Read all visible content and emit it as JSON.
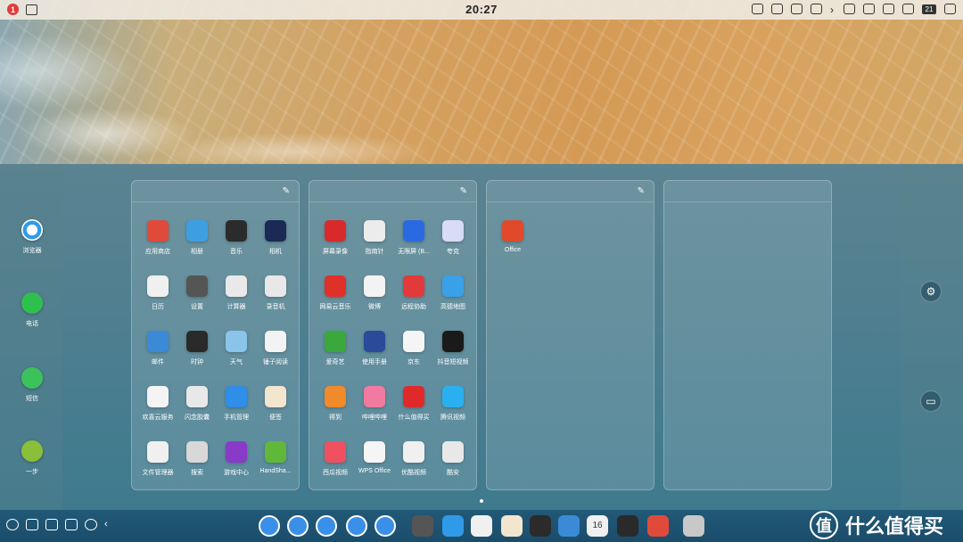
{
  "status_bar": {
    "notification_count": "1",
    "time": "20:27",
    "battery": "21"
  },
  "left_dock": [
    {
      "label": "浏览器",
      "icon": "browser-icon",
      "color": "#2f9be8"
    },
    {
      "label": "电话",
      "icon": "phone-icon",
      "color": "#2fbf4f"
    },
    {
      "label": "短信",
      "icon": "message-icon",
      "color": "#3cc25a"
    },
    {
      "label": "一步",
      "icon": "onestep-icon",
      "color": "#8abf3a"
    }
  ],
  "panels": [
    {
      "edit_icon": "pencil-icon",
      "apps": [
        {
          "label": "应用商店",
          "icon": "app-store-icon",
          "color": "#e04a3a"
        },
        {
          "label": "相册",
          "icon": "gallery-icon",
          "color": "#3d9fe0"
        },
        {
          "label": "音乐",
          "icon": "music-icon",
          "color": "#2b2b2b"
        },
        {
          "label": "相机",
          "icon": "camera-icon",
          "color": "#1a2a55"
        },
        {
          "label": "日历",
          "icon": "calendar-icon",
          "color": "#f0f0f0"
        },
        {
          "label": "设置",
          "icon": "settings-icon",
          "color": "#555"
        },
        {
          "label": "计算器",
          "icon": "calculator-icon",
          "color": "#e9e9e9"
        },
        {
          "label": "录音机",
          "icon": "recorder-icon",
          "color": "#e8e8e8"
        },
        {
          "label": "邮件",
          "icon": "mail-icon",
          "color": "#3a8ad8"
        },
        {
          "label": "时钟",
          "icon": "clock-icon",
          "color": "#2a2a2a"
        },
        {
          "label": "天气",
          "icon": "weather-icon",
          "color": "#8ac4e8"
        },
        {
          "label": "锤子阅读",
          "icon": "reader-icon",
          "color": "#f3f3f3"
        },
        {
          "label": "欢喜云服务",
          "icon": "cloud-icon",
          "color": "#f4f4f4"
        },
        {
          "label": "闪念胶囊",
          "icon": "capsule-icon",
          "color": "#e8e8e8"
        },
        {
          "label": "手机管理",
          "icon": "phone-manager-icon",
          "color": "#2f8ee8"
        },
        {
          "label": "便签",
          "icon": "notes-icon",
          "color": "#f2e6cf"
        },
        {
          "label": "文件管理器",
          "icon": "files-icon",
          "color": "#f0f0f0"
        },
        {
          "label": "搜索",
          "icon": "search-icon",
          "color": "#d8d8d8"
        },
        {
          "label": "游戏中心",
          "icon": "game-center-icon",
          "color": "#8a3ac8"
        },
        {
          "label": "HandSha...",
          "icon": "handshaker-icon",
          "color": "#5fb83a"
        }
      ]
    },
    {
      "edit_icon": "pencil-icon",
      "apps": [
        {
          "label": "屏幕录像",
          "icon": "screen-record-icon",
          "color": "#d82a2a"
        },
        {
          "label": "指南针",
          "icon": "compass-icon",
          "color": "#ececec"
        },
        {
          "label": "无限屏 (B...",
          "icon": "infinite-screen-icon",
          "color": "#2a6ae0"
        },
        {
          "label": "夸克",
          "icon": "quark-icon",
          "color": "#d8dcf5"
        },
        {
          "label": "网易云音乐",
          "icon": "netease-music-icon",
          "color": "#e0302a"
        },
        {
          "label": "微博",
          "icon": "weibo-icon",
          "color": "#f3f3f3"
        },
        {
          "label": "远程协助",
          "icon": "remote-assist-icon",
          "color": "#e23a3a"
        },
        {
          "label": "高德地图",
          "icon": "amap-icon",
          "color": "#3aa0e8"
        },
        {
          "label": "爱奇艺",
          "icon": "iqiyi-icon",
          "color": "#3aa83a"
        },
        {
          "label": "使用手册",
          "icon": "manual-icon",
          "color": "#2a4a9a"
        },
        {
          "label": "京东",
          "icon": "jd-icon",
          "color": "#f5f5f5"
        },
        {
          "label": "抖音短视频",
          "icon": "douyin-icon",
          "color": "#1a1a1a"
        },
        {
          "label": "得到",
          "icon": "dedao-icon",
          "color": "#f08a2a"
        },
        {
          "label": "哔哩哔哩",
          "icon": "bilibili-icon",
          "color": "#f07aa0"
        },
        {
          "label": "什么值得买",
          "icon": "smzdm-icon",
          "color": "#e02a2a"
        },
        {
          "label": "腾讯视频",
          "icon": "tencent-video-icon",
          "color": "#2ab0f0"
        },
        {
          "label": "西瓜视频",
          "icon": "xigua-icon",
          "color": "#f05060"
        },
        {
          "label": "WPS Office",
          "icon": "wps-icon",
          "color": "#f5f5f5"
        },
        {
          "label": "优酷视频",
          "icon": "youku-icon",
          "color": "#f0f0f0"
        },
        {
          "label": "酷安",
          "icon": "coolapk-icon",
          "color": "#e8e8e8"
        }
      ]
    },
    {
      "edit_icon": "pencil-icon",
      "apps": [
        {
          "label": "Office",
          "icon": "office-icon",
          "color": "#e04a2a"
        }
      ]
    },
    {
      "apps": []
    }
  ],
  "right_side": [
    {
      "icon": "settings-icon"
    },
    {
      "icon": "folder-icon"
    }
  ],
  "taskbar": {
    "left_icons": [
      "settings-icon",
      "copy-icon",
      "window-icon",
      "toggle-icon",
      "basket-icon",
      "chevron-left-icon"
    ],
    "apps": [
      {
        "icon": "launcher-icon",
        "color": "#3a90e8"
      },
      {
        "icon": "desktop-icon",
        "color": "#3a90e8"
      },
      {
        "icon": "keyboard-icon",
        "color": "#3a90e8"
      },
      {
        "icon": "workspace-icon",
        "color": "#3a90e8"
      },
      {
        "icon": "grid-icon",
        "color": "#3a90e8"
      },
      {
        "icon": "settings-icon",
        "color": "#555"
      },
      {
        "icon": "browser-icon",
        "color": "#2f9be8"
      },
      {
        "icon": "files-icon",
        "color": "#f0f0f0"
      },
      {
        "icon": "notes-icon",
        "color": "#f2e6cf"
      },
      {
        "icon": "music-icon",
        "color": "#2b2b2b"
      },
      {
        "icon": "mail-icon",
        "color": "#3a8ad8"
      },
      {
        "icon": "calendar-icon",
        "color": "#f0f0f0"
      },
      {
        "icon": "clock-icon",
        "color": "#2a2a2a"
      },
      {
        "icon": "app-store-icon",
        "color": "#e04a3a"
      },
      {
        "icon": "trash-icon",
        "color": "#c8c8c8"
      }
    ],
    "calendar_day": "16"
  },
  "watermark": {
    "text": "什么值得买",
    "logo_glyph": "值"
  }
}
